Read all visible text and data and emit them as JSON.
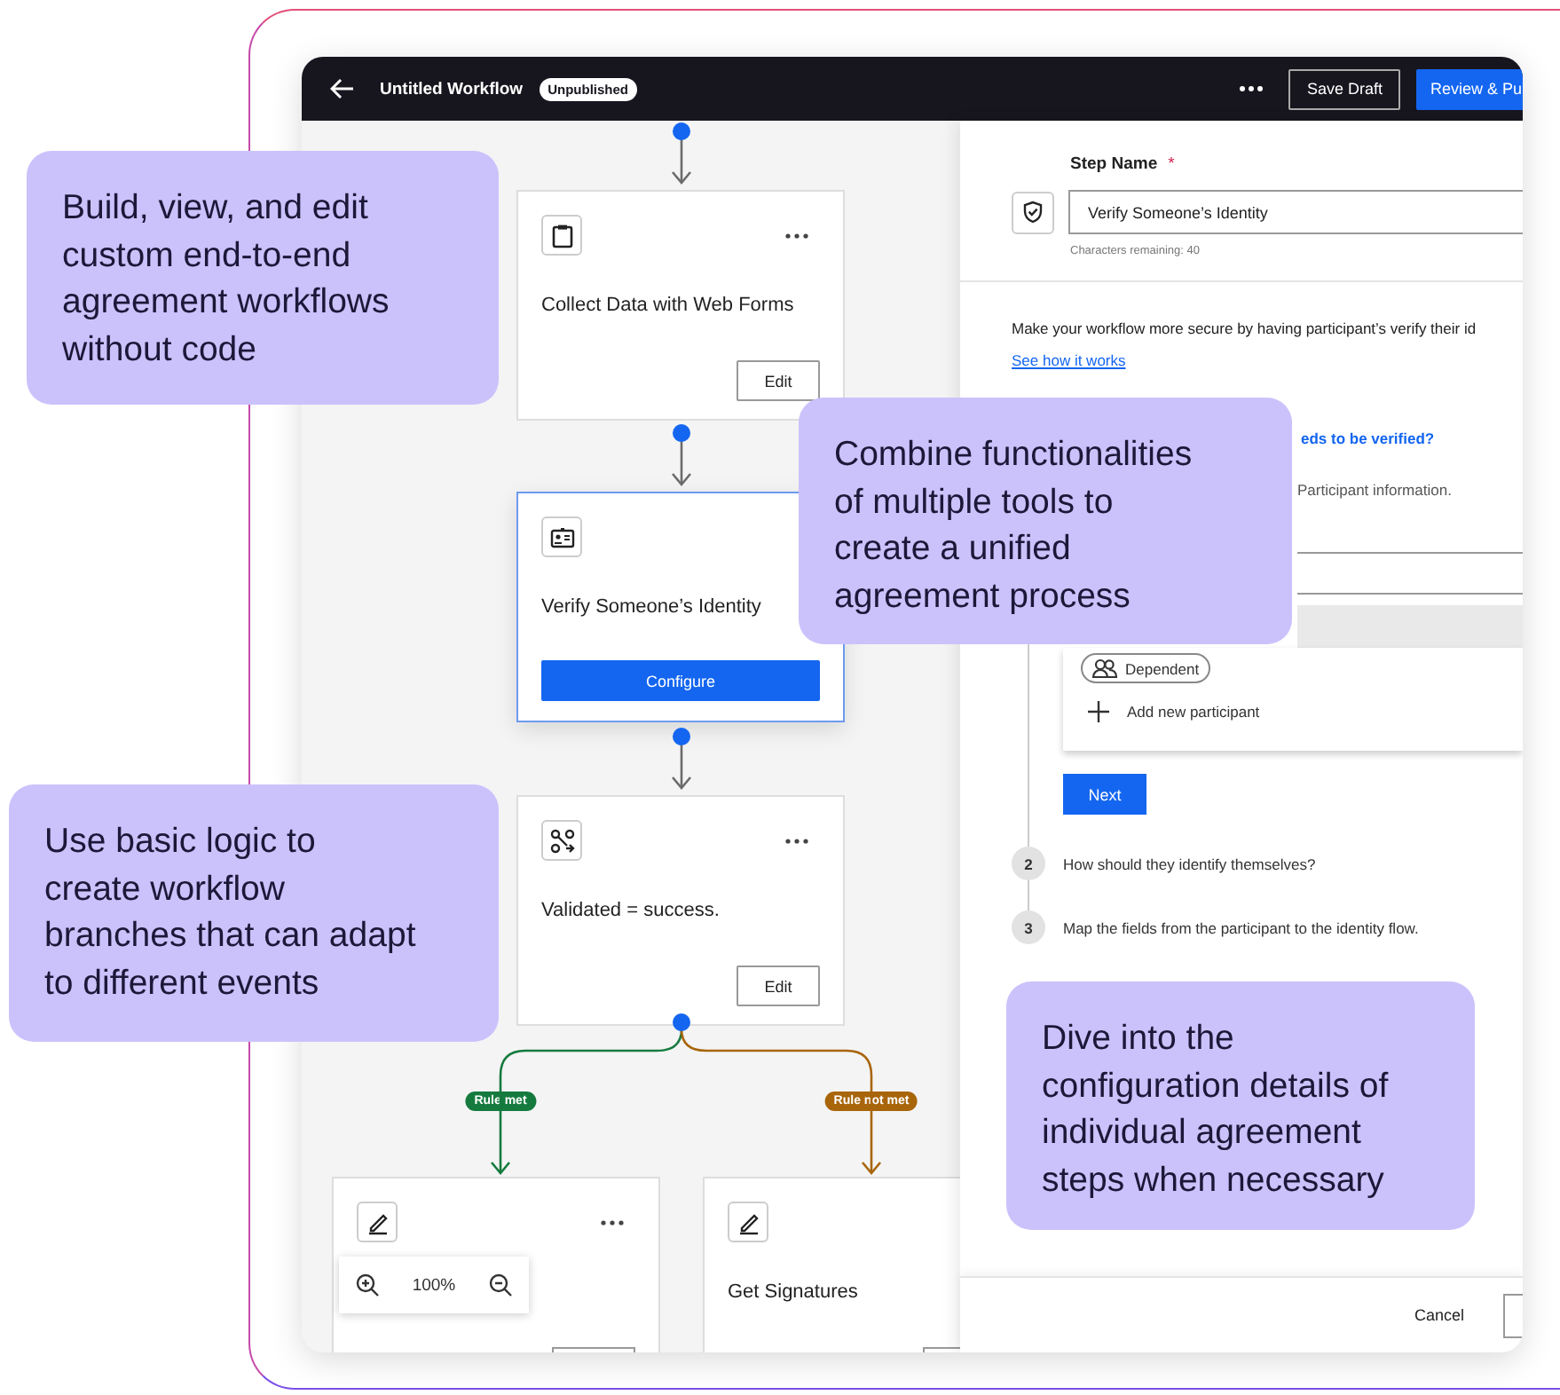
{
  "header": {
    "title": "Untitled Workflow",
    "status": "Unpublished",
    "buttons": [
      {
        "label": "Save Draft",
        "kind": "outline"
      },
      {
        "label": "Review & Pu",
        "kind": "primary"
      }
    ]
  },
  "canvas": {
    "nodes": [
      {
        "kind": "form",
        "title": "Collect Data with Web Forms",
        "selected": false,
        "action": {
          "label": "Edit",
          "kind": "outline"
        }
      },
      {
        "kind": "identity",
        "title": "Verify Someone’s Identity",
        "selected": true,
        "action": {
          "label": "Configure",
          "kind": "primary"
        }
      },
      {
        "kind": "logic",
        "title": "Validated = success.",
        "selected": false,
        "action": {
          "label": "Edit",
          "kind": "outline"
        }
      }
    ],
    "branches": [
      {
        "label": "Rule met",
        "color": "#157a3e",
        "node": {
          "kind": "signature"
        }
      },
      {
        "label": "Rule not met",
        "color": "#a8650a",
        "node": {
          "kind": "signature",
          "title": "Get Signatures"
        }
      }
    ],
    "zoom": {
      "value": "100%"
    }
  },
  "panel": {
    "step_name_label": "Step Name",
    "required_mark": "*",
    "step_name_value": "Verify Someone’s Identity",
    "counter": "Characters remaining: 40",
    "description": "Make your workflow more secure by having participant’s verify their id",
    "link": "See how it works",
    "question": "eds to be verified?",
    "info": "Participant information.",
    "participants": [
      {
        "label": "Dependent"
      }
    ],
    "add_label": "Add new participant",
    "next": "Next",
    "steps": [
      {
        "number": "2",
        "text": "How should they identify themselves?"
      },
      {
        "number": "3",
        "text": "Map the fields from the participant to the identity flow."
      }
    ],
    "footer": {
      "cancel": "Cancel"
    }
  },
  "callouts": [
    {
      "text": "Build, view, and edit\ncustom end-to-end\nagreement workflows\nwithout code"
    },
    {
      "text": "Combine functionalities\nof multiple tools to\ncreate a unified\nagreement process"
    },
    {
      "text": "Use basic logic to\ncreate workflow\nbranches that can adapt\nto different events"
    },
    {
      "text": "Dive into the\nconfiguration details of\nindividual agreement\nsteps when necessary"
    }
  ]
}
